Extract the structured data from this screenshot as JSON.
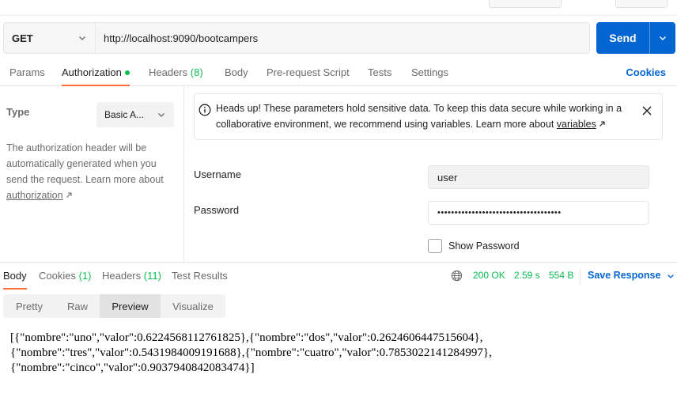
{
  "request": {
    "method": "GET",
    "url": "http://localhost:9090/bootcampers",
    "send_label": "Send"
  },
  "request_tabs": {
    "params": "Params",
    "authorization": "Authorization",
    "headers": "Headers",
    "headers_count": "(8)",
    "body": "Body",
    "pre_request": "Pre-request Script",
    "tests": "Tests",
    "settings": "Settings",
    "cookies": "Cookies"
  },
  "auth": {
    "type_label": "Type",
    "type_value": "Basic A...",
    "description": "The authorization header will be automatically generated when you send the request. Learn more about",
    "description_link": "authorization",
    "notice_text": "Heads up! These parameters hold sensitive data. To keep this data secure while working in a collaborative environment, we recommend using variables. Learn more about",
    "notice_link": "variables",
    "username_label": "Username",
    "username_value": "user",
    "password_label": "Password",
    "password_value": "••••••••••••••••••••••••••••••••••••",
    "show_password_label": "Show Password"
  },
  "response_tabs": {
    "body": "Body",
    "cookies": "Cookies",
    "cookies_count": "(1)",
    "headers": "Headers",
    "headers_count": "(11)",
    "test_results": "Test Results"
  },
  "response_meta": {
    "status": "200 OK",
    "time": "2.59 s",
    "size": "554 B",
    "save_response": "Save Response"
  },
  "view_modes": {
    "pretty": "Pretty",
    "raw": "Raw",
    "preview": "Preview",
    "visualize": "Visualize",
    "selected": "Preview"
  },
  "preview_lines": [
    "[{\"nombre\":\"uno\",\"valor\":0.6224568112761825},{\"nombre\":\"dos\",\"valor\":0.2624606447515604},",
    "{\"nombre\":\"tres\",\"valor\":0.5431984009191688},{\"nombre\":\"cuatro\",\"valor\":0.7853022141284997},",
    "{\"nombre\":\"cinco\",\"valor\":0.9037940842083474}]"
  ],
  "colors": {
    "accent_blue": "#0265d2",
    "tab_indicator": "#ff6c37",
    "success_green": "#0cbb52"
  }
}
